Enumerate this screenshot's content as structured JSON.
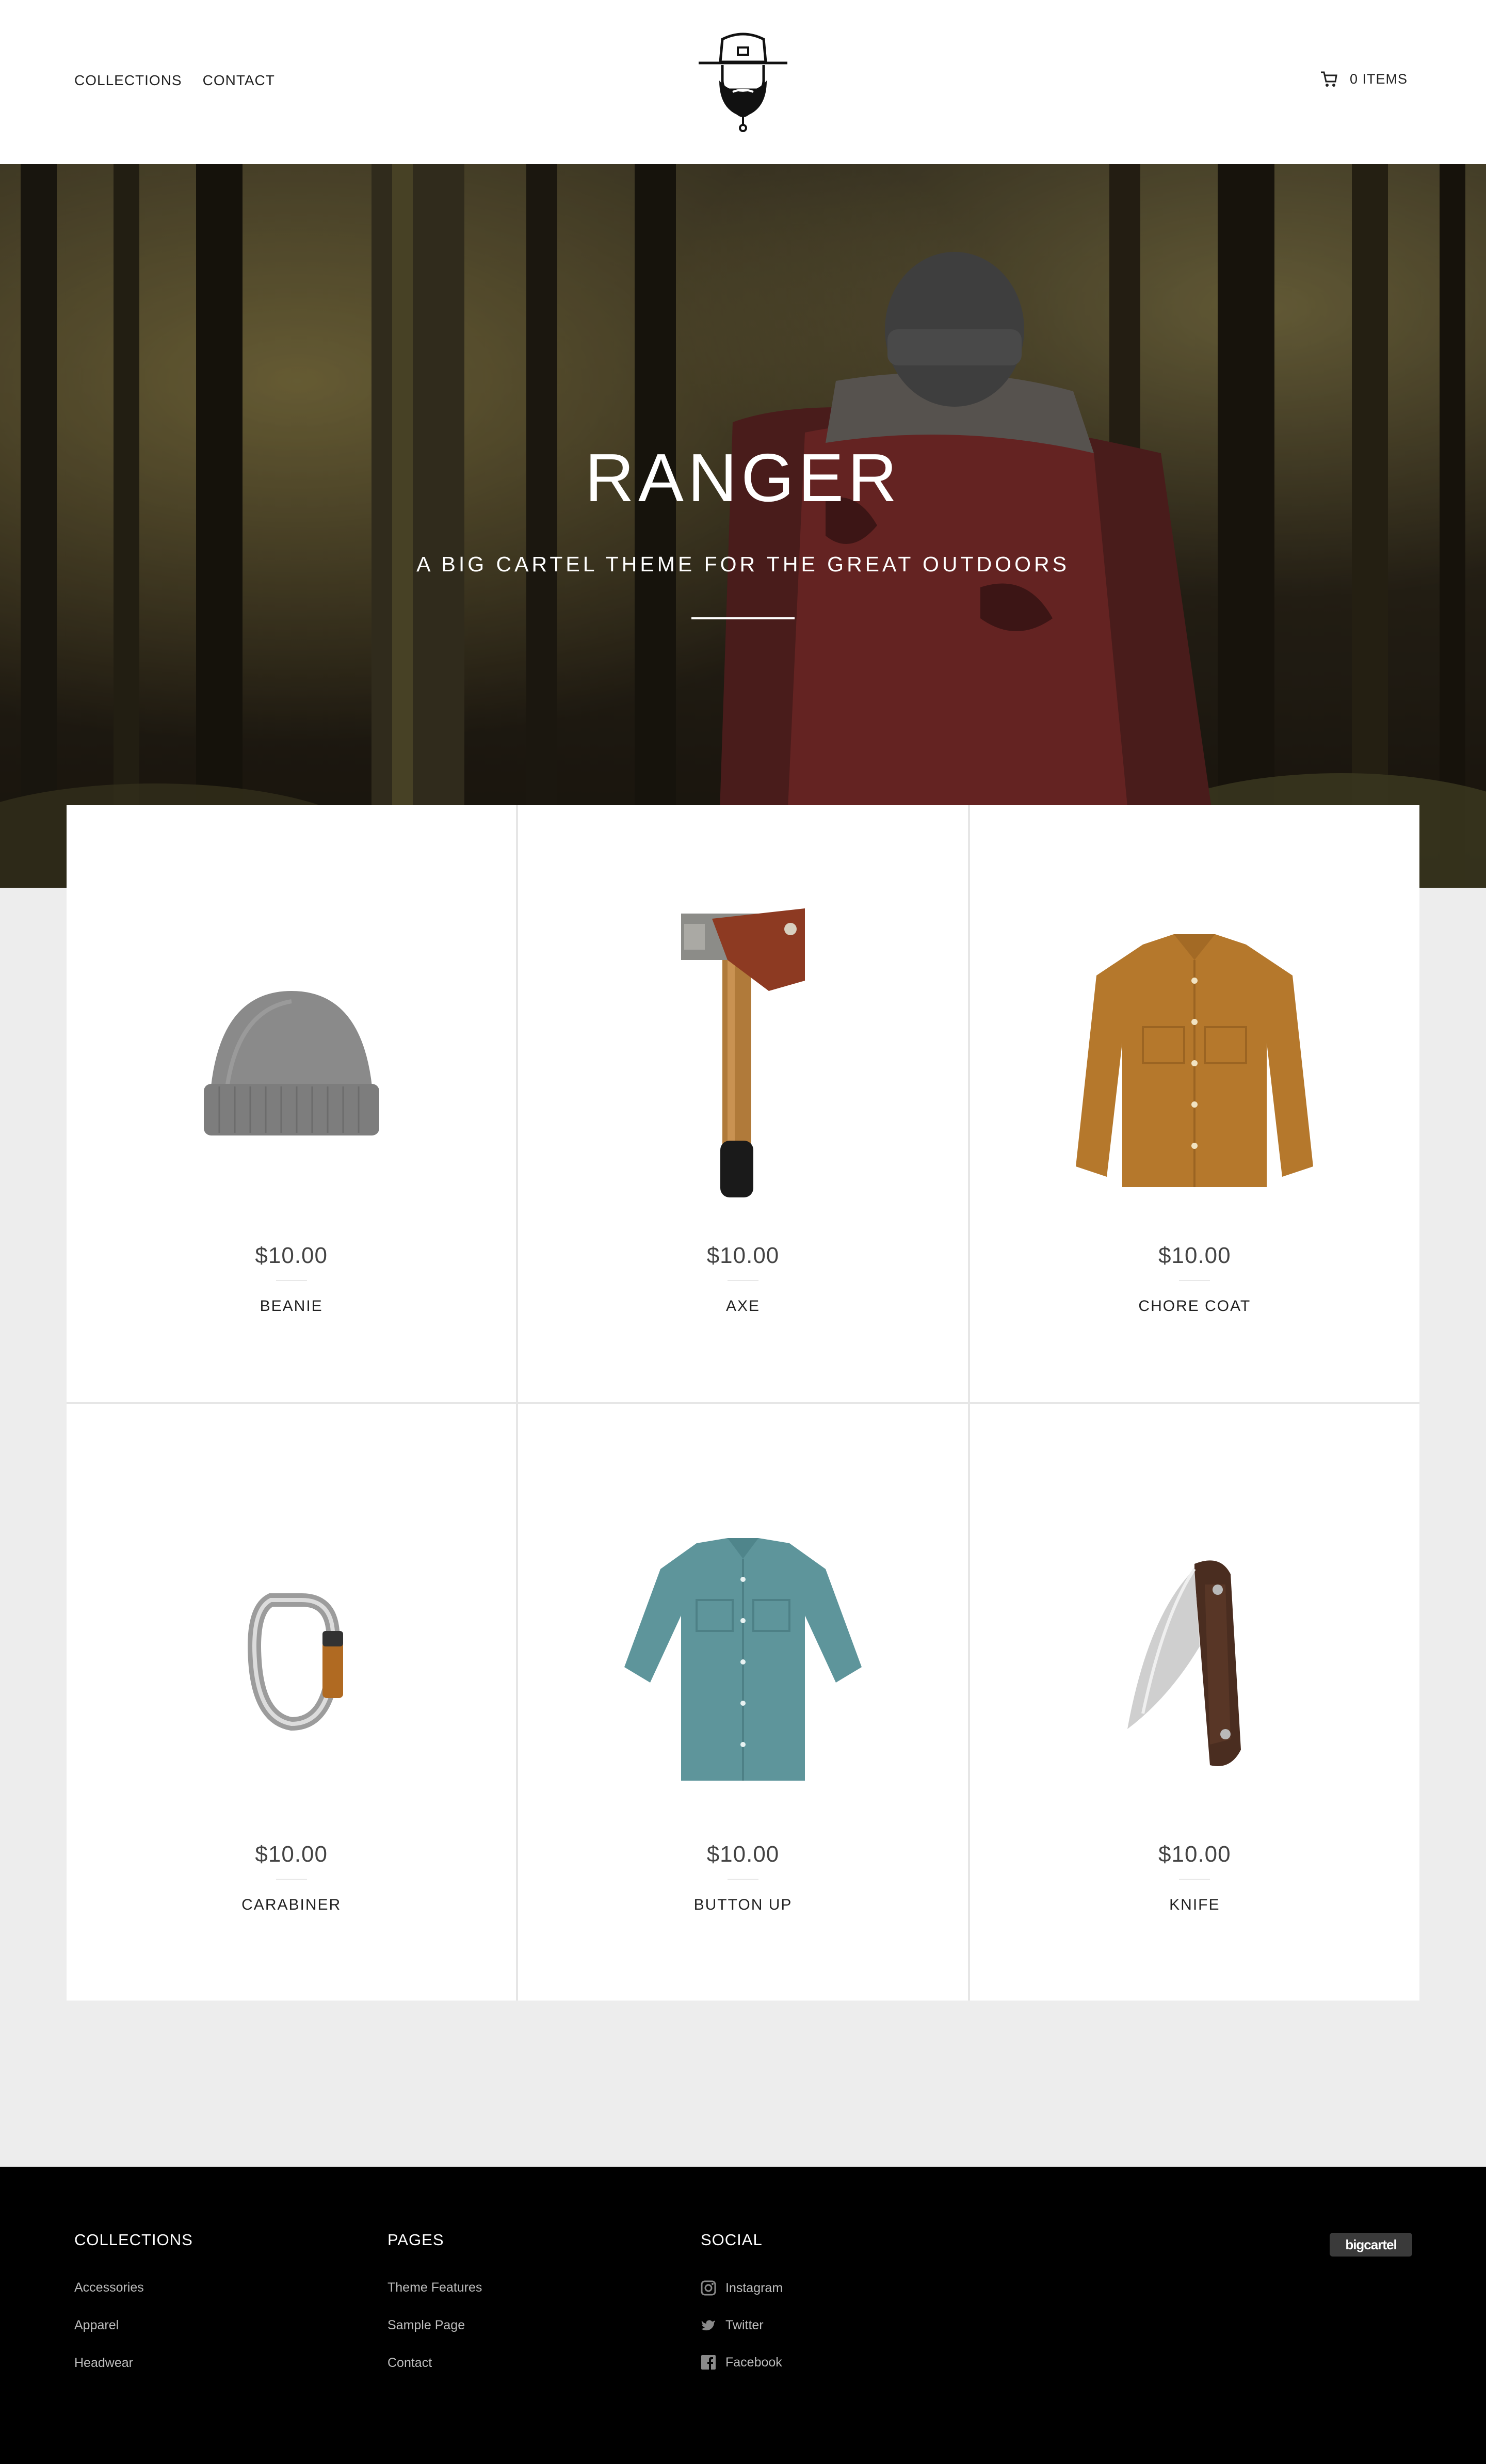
{
  "header": {
    "nav": [
      "COLLECTIONS",
      "CONTACT"
    ],
    "cart_label": "0 ITEMS"
  },
  "hero": {
    "title": "RANGER",
    "subtitle": "A BIG CARTEL THEME FOR THE GREAT OUTDOORS"
  },
  "products": [
    {
      "name": "BEANIE",
      "price": "$10.00",
      "icon": "beanie-image"
    },
    {
      "name": "AXE",
      "price": "$10.00",
      "icon": "axe-image"
    },
    {
      "name": "CHORE COAT",
      "price": "$10.00",
      "icon": "chore-coat-image"
    },
    {
      "name": "CARABINER",
      "price": "$10.00",
      "icon": "carabiner-image"
    },
    {
      "name": "BUTTON UP",
      "price": "$10.00",
      "icon": "button-up-image"
    },
    {
      "name": "KNIFE",
      "price": "$10.00",
      "icon": "knife-image"
    }
  ],
  "footer": {
    "collections": {
      "heading": "COLLECTIONS",
      "links": [
        "Accessories",
        "Apparel",
        "Headwear"
      ]
    },
    "pages": {
      "heading": "PAGES",
      "links": [
        "Theme Features",
        "Sample Page",
        "Contact"
      ]
    },
    "social": {
      "heading": "SOCIAL",
      "links": [
        "Instagram",
        "Twitter",
        "Facebook"
      ]
    },
    "badge": "bigcartel"
  },
  "colors": {
    "header_bg": "#ffffff",
    "page_bg": "#ededed",
    "footer_bg": "#000000",
    "footer_link": "#bdbdbd"
  }
}
